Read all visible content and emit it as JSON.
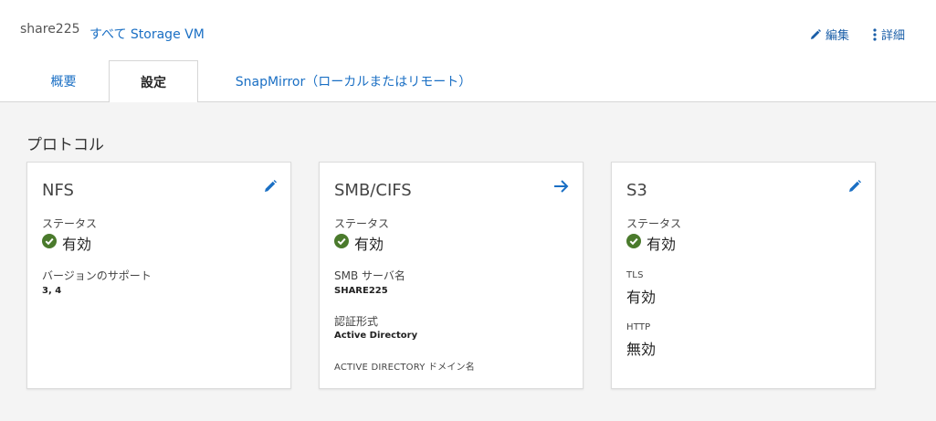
{
  "header": {
    "vm_name": "share225",
    "all_vm_link": "すべて Storage VM",
    "edit_label": "編集",
    "detail_label": "詳細"
  },
  "tabs": [
    {
      "label": "概要"
    },
    {
      "label": "設定",
      "active": true
    },
    {
      "label": "SnapMirror（ローカルまたはリモート）"
    }
  ],
  "section": {
    "title": "プロトコル"
  },
  "cards": {
    "nfs": {
      "title": "NFS",
      "status_label": "ステータス",
      "status_value": "有効",
      "version_label": "バージョンのサポート",
      "version_value": "3, 4"
    },
    "smb": {
      "title": "SMB/CIFS",
      "status_label": "ステータス",
      "status_value": "有効",
      "server_label": "SMB サーバ名",
      "server_value": "SHARE225",
      "auth_label": "認証形式",
      "auth_value": "Active Directory",
      "domain_label": "ACTIVE DIRECTORY ドメイン名"
    },
    "s3": {
      "title": "S3",
      "status_label": "ステータス",
      "status_value": "有効",
      "tls_label": "TLS",
      "tls_value": "有効",
      "http_label": "HTTP",
      "http_value": "無効"
    }
  },
  "colors": {
    "accent": "#1a6fc4",
    "status_ok": "#4a7a2c"
  },
  "icons": {
    "edit": "pencil-icon",
    "detail": "kebab-vertical-icon",
    "navigate": "arrow-right-icon",
    "status": "check-circle-icon"
  }
}
